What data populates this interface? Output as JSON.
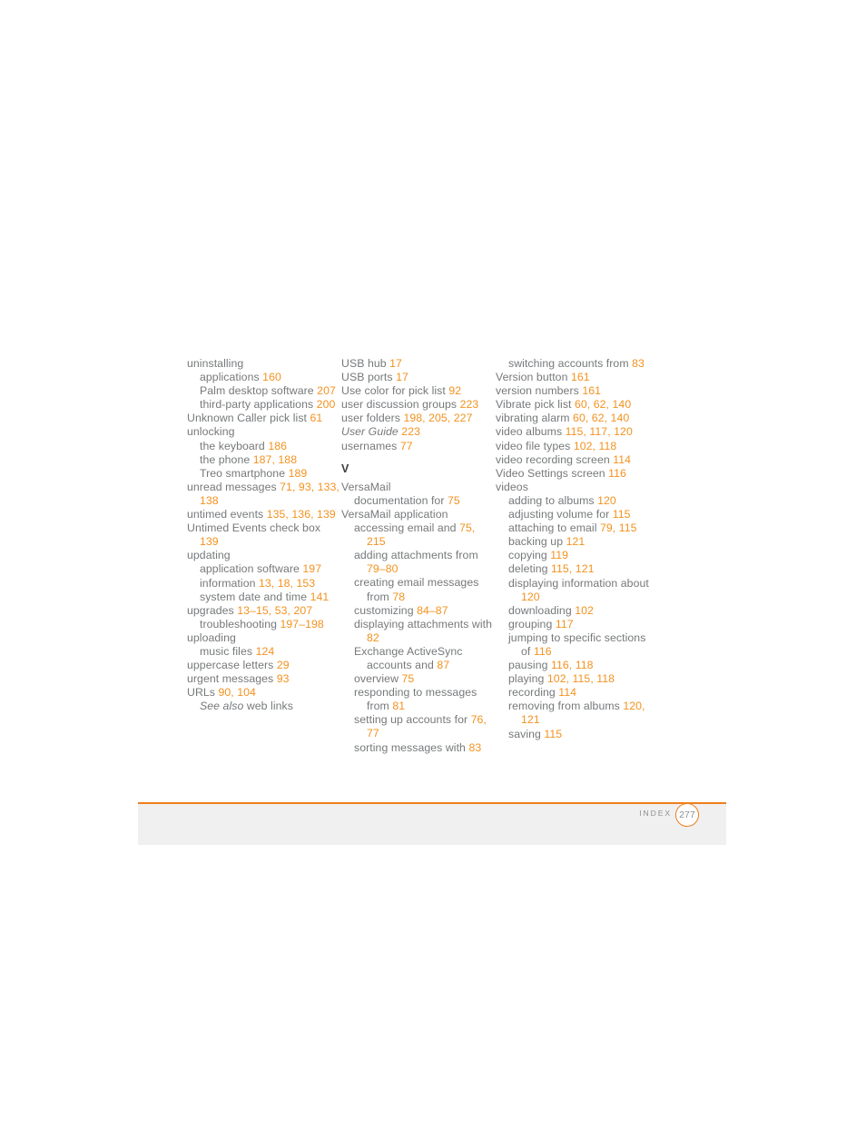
{
  "document": {
    "kind": "printed-manual-index-page",
    "footer": {
      "section_label": "INDEX",
      "page_number": "277"
    },
    "colors": {
      "accent_orange": "#f3921f",
      "rule_orange": "#ee7f1c",
      "body_gray": "#76787a",
      "heading_gray": "#3f3f3f",
      "footer_band_gray": "#f0f0f0",
      "footer_label_gray": "#8e9092"
    }
  },
  "columns": [
    {
      "id": "column-1",
      "blocks": [
        {
          "type": "entry",
          "level": 0,
          "runs": [
            {
              "t": "uninstalling"
            }
          ]
        },
        {
          "type": "entry",
          "level": 1,
          "runs": [
            {
              "t": "applications "
            },
            {
              "t": "160",
              "s": "num"
            }
          ]
        },
        {
          "type": "entry",
          "level": 1,
          "runs": [
            {
              "t": "Palm desktop software "
            },
            {
              "t": "207",
              "s": "num"
            }
          ]
        },
        {
          "type": "entry",
          "level": 1,
          "runs": [
            {
              "t": "third-party applications "
            },
            {
              "t": "200",
              "s": "num"
            }
          ]
        },
        {
          "type": "entry",
          "level": 0,
          "runs": [
            {
              "t": "Unknown Caller pick list "
            },
            {
              "t": "61",
              "s": "num"
            }
          ]
        },
        {
          "type": "entry",
          "level": 0,
          "runs": [
            {
              "t": "unlocking"
            }
          ]
        },
        {
          "type": "entry",
          "level": 1,
          "runs": [
            {
              "t": "the keyboard "
            },
            {
              "t": "186",
              "s": "num"
            }
          ]
        },
        {
          "type": "entry",
          "level": 1,
          "runs": [
            {
              "t": "the phone "
            },
            {
              "t": "187, 188",
              "s": "num"
            }
          ]
        },
        {
          "type": "entry",
          "level": 1,
          "runs": [
            {
              "t": "Treo smartphone "
            },
            {
              "t": "189",
              "s": "num"
            }
          ]
        },
        {
          "type": "entry",
          "level": 0,
          "runs": [
            {
              "t": "unread messages "
            },
            {
              "t": "71, 93, 133, 138",
              "s": "num"
            }
          ]
        },
        {
          "type": "entry",
          "level": 0,
          "runs": [
            {
              "t": "untimed events "
            },
            {
              "t": "135, 136, 139",
              "s": "num"
            }
          ]
        },
        {
          "type": "entry",
          "level": 0,
          "runs": [
            {
              "t": "Untimed Events check box "
            },
            {
              "t": "139",
              "s": "num"
            }
          ]
        },
        {
          "type": "entry",
          "level": 0,
          "runs": [
            {
              "t": "updating"
            }
          ]
        },
        {
          "type": "entry",
          "level": 1,
          "runs": [
            {
              "t": "application software "
            },
            {
              "t": "197",
              "s": "num"
            }
          ]
        },
        {
          "type": "entry",
          "level": 1,
          "runs": [
            {
              "t": "information "
            },
            {
              "t": "13, 18, 153",
              "s": "num"
            }
          ]
        },
        {
          "type": "entry",
          "level": 1,
          "runs": [
            {
              "t": "system date and time "
            },
            {
              "t": "141",
              "s": "num"
            }
          ]
        },
        {
          "type": "entry",
          "level": 0,
          "runs": [
            {
              "t": "upgrades "
            },
            {
              "t": "13–15, 53, 207",
              "s": "num"
            }
          ]
        },
        {
          "type": "entry",
          "level": 1,
          "runs": [
            {
              "t": "troubleshooting "
            },
            {
              "t": "197–198",
              "s": "num"
            }
          ]
        },
        {
          "type": "entry",
          "level": 0,
          "runs": [
            {
              "t": "uploading"
            }
          ]
        },
        {
          "type": "entry",
          "level": 1,
          "runs": [
            {
              "t": "music files "
            },
            {
              "t": "124",
              "s": "num"
            }
          ]
        },
        {
          "type": "entry",
          "level": 0,
          "runs": [
            {
              "t": "uppercase letters "
            },
            {
              "t": "29",
              "s": "num"
            }
          ]
        },
        {
          "type": "entry",
          "level": 0,
          "runs": [
            {
              "t": "urgent messages "
            },
            {
              "t": "93",
              "s": "num"
            }
          ]
        },
        {
          "type": "entry",
          "level": 0,
          "runs": [
            {
              "t": "URLs "
            },
            {
              "t": "90, 104",
              "s": "num"
            }
          ]
        },
        {
          "type": "entry",
          "level": 1,
          "runs": [
            {
              "t": "See also",
              "s": "ital"
            },
            {
              "t": " web links"
            }
          ]
        }
      ]
    },
    {
      "id": "column-2",
      "blocks": [
        {
          "type": "entry",
          "level": 0,
          "runs": [
            {
              "t": "USB hub "
            },
            {
              "t": "17",
              "s": "num"
            }
          ]
        },
        {
          "type": "entry",
          "level": 0,
          "runs": [
            {
              "t": "USB ports "
            },
            {
              "t": "17",
              "s": "num"
            }
          ]
        },
        {
          "type": "entry",
          "level": 0,
          "runs": [
            {
              "t": "Use color for pick list "
            },
            {
              "t": "92",
              "s": "num"
            }
          ]
        },
        {
          "type": "entry",
          "level": 0,
          "runs": [
            {
              "t": "user discussion groups "
            },
            {
              "t": "223",
              "s": "num"
            }
          ]
        },
        {
          "type": "entry",
          "level": 0,
          "runs": [
            {
              "t": "user folders "
            },
            {
              "t": "198, 205, 227",
              "s": "num"
            }
          ]
        },
        {
          "type": "entry",
          "level": 0,
          "runs": [
            {
              "t": "User Guide",
              "s": "ital"
            },
            {
              "t": " "
            },
            {
              "t": "223",
              "s": "num"
            }
          ]
        },
        {
          "type": "entry",
          "level": 0,
          "runs": [
            {
              "t": "usernames "
            },
            {
              "t": "77",
              "s": "num"
            }
          ]
        },
        {
          "type": "heading",
          "letter": "V"
        },
        {
          "type": "entry",
          "level": 0,
          "runs": [
            {
              "t": "VersaMail"
            }
          ]
        },
        {
          "type": "entry",
          "level": 1,
          "runs": [
            {
              "t": "documentation for "
            },
            {
              "t": "75",
              "s": "num"
            }
          ]
        },
        {
          "type": "entry",
          "level": 0,
          "runs": [
            {
              "t": "VersaMail application"
            }
          ]
        },
        {
          "type": "entry",
          "level": 1,
          "runs": [
            {
              "t": "accessing email and "
            },
            {
              "t": "75, 215",
              "s": "num"
            }
          ]
        },
        {
          "type": "entry",
          "level": 1,
          "runs": [
            {
              "t": "adding attachments from "
            },
            {
              "t": "79–80",
              "s": "num"
            }
          ]
        },
        {
          "type": "entry",
          "level": 1,
          "runs": [
            {
              "t": "creating email messages from "
            },
            {
              "t": "78",
              "s": "num"
            }
          ]
        },
        {
          "type": "entry",
          "level": 1,
          "runs": [
            {
              "t": "customizing "
            },
            {
              "t": "84–87",
              "s": "num"
            }
          ]
        },
        {
          "type": "entry",
          "level": 1,
          "runs": [
            {
              "t": "displaying attachments with "
            },
            {
              "t": "82",
              "s": "num"
            }
          ]
        },
        {
          "type": "entry",
          "level": 1,
          "runs": [
            {
              "t": "Exchange ActiveSync accounts and "
            },
            {
              "t": "87",
              "s": "num"
            }
          ]
        },
        {
          "type": "entry",
          "level": 1,
          "runs": [
            {
              "t": "overview "
            },
            {
              "t": "75",
              "s": "num"
            }
          ]
        },
        {
          "type": "entry",
          "level": 1,
          "runs": [
            {
              "t": "responding to messages from "
            },
            {
              "t": "81",
              "s": "num"
            }
          ]
        },
        {
          "type": "entry",
          "level": 1,
          "runs": [
            {
              "t": "setting up accounts for "
            },
            {
              "t": "76, 77",
              "s": "num"
            }
          ]
        },
        {
          "type": "entry",
          "level": 1,
          "runs": [
            {
              "t": "sorting messages with "
            },
            {
              "t": "83",
              "s": "num"
            }
          ]
        }
      ]
    },
    {
      "id": "column-3",
      "blocks": [
        {
          "type": "entry",
          "level": 1,
          "runs": [
            {
              "t": "switching accounts from "
            },
            {
              "t": "83",
              "s": "num"
            }
          ]
        },
        {
          "type": "entry",
          "level": 0,
          "runs": [
            {
              "t": "Version button "
            },
            {
              "t": "161",
              "s": "num"
            }
          ]
        },
        {
          "type": "entry",
          "level": 0,
          "runs": [
            {
              "t": "version numbers "
            },
            {
              "t": "161",
              "s": "num"
            }
          ]
        },
        {
          "type": "entry",
          "level": 0,
          "runs": [
            {
              "t": "Vibrate pick list "
            },
            {
              "t": "60, 62, 140",
              "s": "num"
            }
          ]
        },
        {
          "type": "entry",
          "level": 0,
          "runs": [
            {
              "t": "vibrating alarm "
            },
            {
              "t": "60, 62, 140",
              "s": "num"
            }
          ]
        },
        {
          "type": "entry",
          "level": 0,
          "runs": [
            {
              "t": "video albums "
            },
            {
              "t": "115, 117, 120",
              "s": "num"
            }
          ]
        },
        {
          "type": "entry",
          "level": 0,
          "runs": [
            {
              "t": "video file types "
            },
            {
              "t": "102, 118",
              "s": "num"
            }
          ]
        },
        {
          "type": "entry",
          "level": 0,
          "runs": [
            {
              "t": "video recording screen "
            },
            {
              "t": "114",
              "s": "num"
            }
          ]
        },
        {
          "type": "entry",
          "level": 0,
          "runs": [
            {
              "t": "Video Settings screen "
            },
            {
              "t": "116",
              "s": "num"
            }
          ]
        },
        {
          "type": "entry",
          "level": 0,
          "runs": [
            {
              "t": "videos"
            }
          ]
        },
        {
          "type": "entry",
          "level": 1,
          "runs": [
            {
              "t": "adding to albums "
            },
            {
              "t": "120",
              "s": "num"
            }
          ]
        },
        {
          "type": "entry",
          "level": 1,
          "runs": [
            {
              "t": "adjusting volume for "
            },
            {
              "t": "115",
              "s": "num"
            }
          ]
        },
        {
          "type": "entry",
          "level": 1,
          "runs": [
            {
              "t": "attaching to email "
            },
            {
              "t": "79, 115",
              "s": "num"
            }
          ]
        },
        {
          "type": "entry",
          "level": 1,
          "runs": [
            {
              "t": "backing up "
            },
            {
              "t": "121",
              "s": "num"
            }
          ]
        },
        {
          "type": "entry",
          "level": 1,
          "runs": [
            {
              "t": "copying "
            },
            {
              "t": "119",
              "s": "num"
            }
          ]
        },
        {
          "type": "entry",
          "level": 1,
          "runs": [
            {
              "t": "deleting "
            },
            {
              "t": "115, 121",
              "s": "num"
            }
          ]
        },
        {
          "type": "entry",
          "level": 1,
          "runs": [
            {
              "t": "displaying information about "
            },
            {
              "t": "120",
              "s": "num"
            }
          ]
        },
        {
          "type": "entry",
          "level": 1,
          "runs": [
            {
              "t": "downloading "
            },
            {
              "t": "102",
              "s": "num"
            }
          ]
        },
        {
          "type": "entry",
          "level": 1,
          "runs": [
            {
              "t": "grouping "
            },
            {
              "t": "117",
              "s": "num"
            }
          ]
        },
        {
          "type": "entry",
          "level": 1,
          "runs": [
            {
              "t": "jumping to specific sections of "
            },
            {
              "t": "116",
              "s": "num"
            }
          ]
        },
        {
          "type": "entry",
          "level": 1,
          "runs": [
            {
              "t": "pausing "
            },
            {
              "t": "116, 118",
              "s": "num"
            }
          ]
        },
        {
          "type": "entry",
          "level": 1,
          "runs": [
            {
              "t": "playing "
            },
            {
              "t": "102, 115, 118",
              "s": "num"
            }
          ]
        },
        {
          "type": "entry",
          "level": 1,
          "runs": [
            {
              "t": "recording "
            },
            {
              "t": "114",
              "s": "num"
            }
          ]
        },
        {
          "type": "entry",
          "level": 1,
          "runs": [
            {
              "t": "removing from albums "
            },
            {
              "t": "120, 121",
              "s": "num"
            }
          ]
        },
        {
          "type": "entry",
          "level": 1,
          "runs": [
            {
              "t": "saving "
            },
            {
              "t": "115",
              "s": "num"
            }
          ]
        }
      ]
    }
  ]
}
